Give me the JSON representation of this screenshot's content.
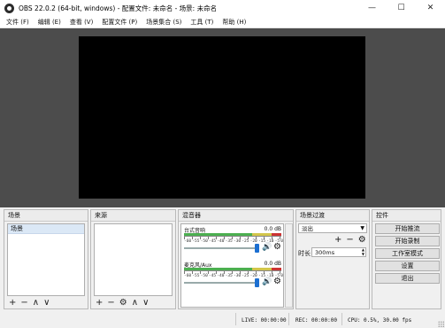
{
  "window": {
    "title": "OBS 22.0.2 (64-bit, windows) - 配置文件: 未命名 - 场景: 未命名",
    "minimize": "—",
    "maximize": "☐",
    "close": "✕"
  },
  "menu": [
    "文件 (F)",
    "编辑 (E)",
    "查看 (V)",
    "配置文件 (P)",
    "场景集合 (S)",
    "工具 (T)",
    "帮助 (H)"
  ],
  "docks": {
    "scenes": {
      "title": "场景",
      "items": [
        "场景"
      ],
      "add": "+",
      "remove": "−",
      "up": "∧",
      "down": "∨"
    },
    "sources": {
      "title": "来源",
      "add": "+",
      "remove": "−",
      "settings": "⚙",
      "up": "∧",
      "down": "∨"
    },
    "mixer": {
      "title": "混音器",
      "channels": [
        {
          "name": "台式音响",
          "db": "0.0 dB",
          "volume": 1.0,
          "muted": false
        },
        {
          "name": "麦克风/Aux",
          "db": "0.0 dB",
          "volume": 1.0,
          "muted": false
        }
      ],
      "tick_labels": [
        "-60",
        "-55",
        "-50",
        "-45",
        "-40",
        "-35",
        "-30",
        "-25",
        "-20",
        "-15",
        "-10",
        "-5",
        "0"
      ],
      "volume_icon": "🔊",
      "gear_icon": "⚙"
    },
    "transitions": {
      "title": "场景过渡",
      "selected": "淡出",
      "add": "+",
      "remove": "−",
      "settings": "⚙",
      "duration_label": "时长",
      "duration_value": "300ms"
    },
    "controls": {
      "title": "控件",
      "buttons": [
        "开始推流",
        "开始录制",
        "工作室模式",
        "设置",
        "退出"
      ]
    }
  },
  "status": {
    "live": "LIVE: 00:00:00",
    "rec": "REC: 00:00:00",
    "cpu": "CPU: 0.5%, 30.00 fps"
  },
  "colors": {
    "preview_bg": "#4c4c4c",
    "canvas": "#000000",
    "meter_green": "#4caf50",
    "meter_yellow": "#d3c64b",
    "meter_red": "#cc3333",
    "slider_thumb": "#1c6fd1"
  }
}
